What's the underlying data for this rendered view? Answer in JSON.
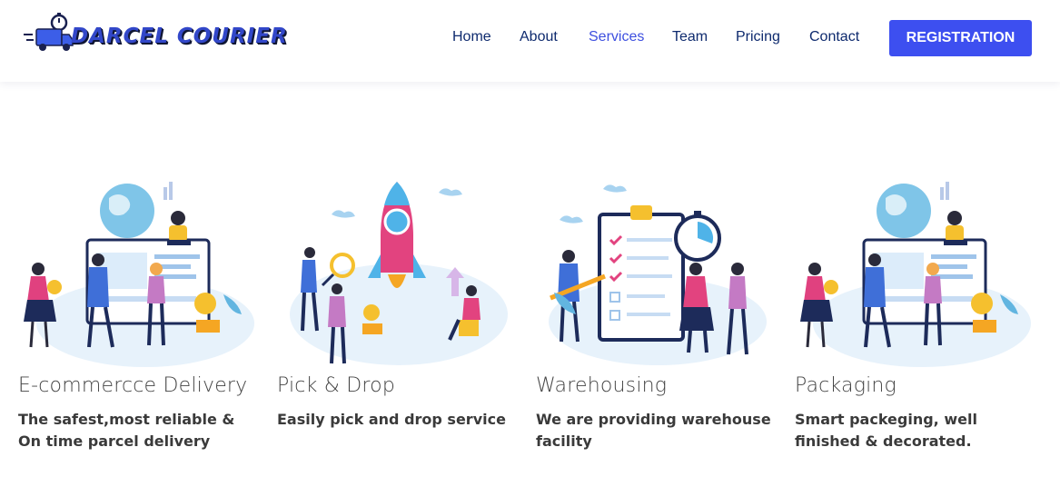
{
  "brand": {
    "name": "DARCEL COURIER",
    "icon": "delivery-truck-stopwatch-icon"
  },
  "nav": {
    "items": [
      {
        "label": "Home",
        "active": false
      },
      {
        "label": "About",
        "active": false
      },
      {
        "label": "Services",
        "active": true
      },
      {
        "label": "Team",
        "active": false
      },
      {
        "label": "Pricing",
        "active": false
      },
      {
        "label": "Contact",
        "active": false
      }
    ],
    "cta_label": "REGISTRATION"
  },
  "services": [
    {
      "title": "E-commercce Delivery",
      "description": "The safest,most reliable & On time parcel delivery",
      "illustration": "ecommerce-team-illustration"
    },
    {
      "title": "Pick & Drop",
      "description": "Easily pick and drop service",
      "illustration": "rocket-launch-illustration"
    },
    {
      "title": "Warehousing",
      "description": "We are providing warehouse facility",
      "illustration": "checklist-stopwatch-illustration"
    },
    {
      "title": "Packaging",
      "description": "Smart packeging, well finished & decorated.",
      "illustration": "ecommerce-team-illustration"
    }
  ],
  "colors": {
    "accent": "#3d4ff0",
    "nav_text": "#0e2a6e",
    "nav_active": "#3d4fdf",
    "body_text": "#3a3a3a"
  }
}
